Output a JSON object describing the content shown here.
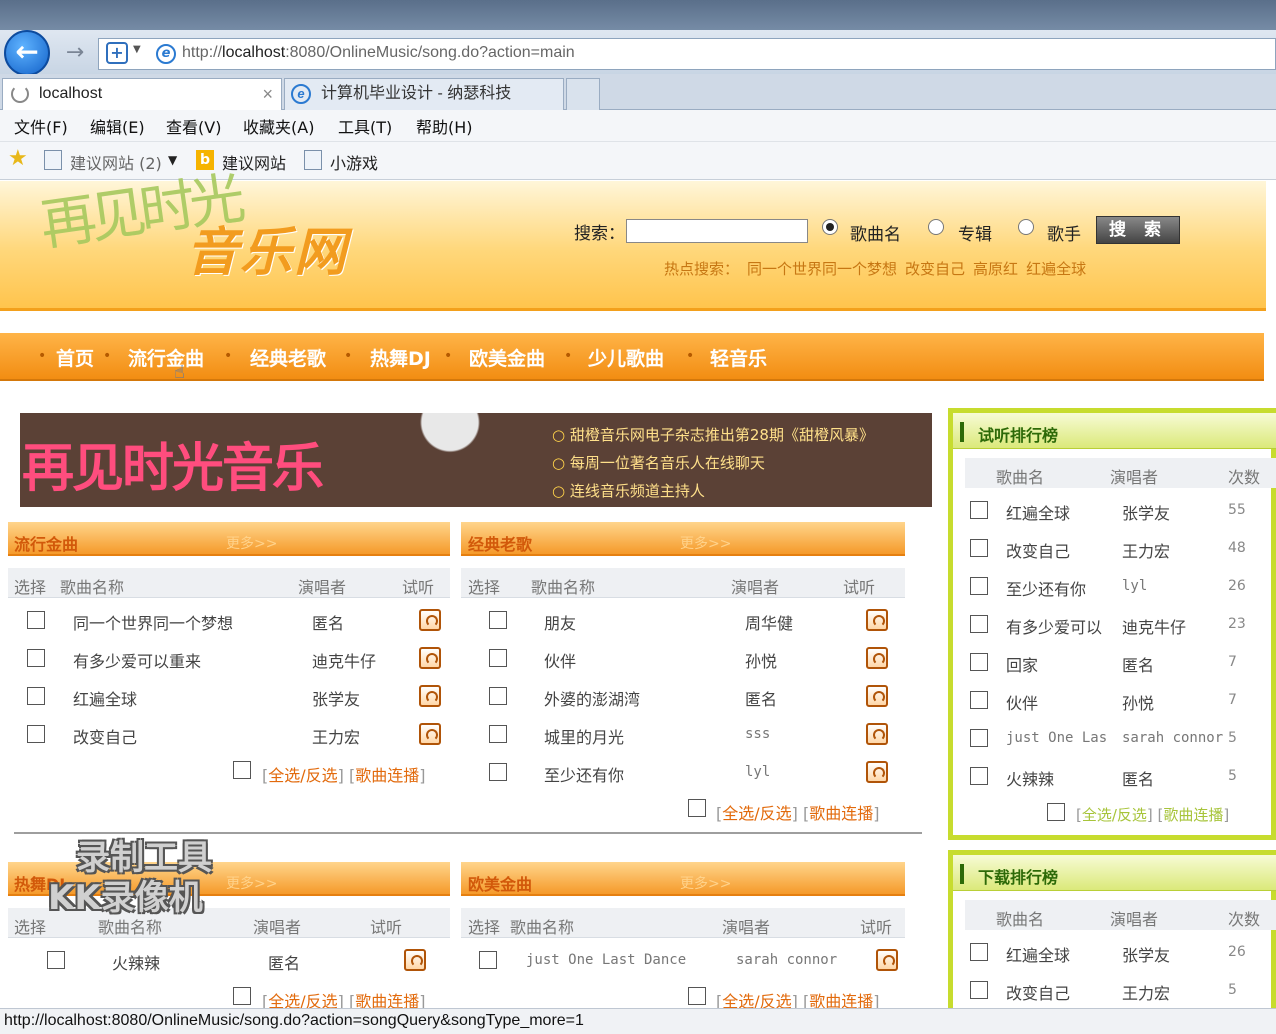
{
  "browser": {
    "url_prefix": "http://",
    "url_host": "localhost",
    "url_rest": ":8080/OnlineMusic/song.do?action=main",
    "tabs": [
      {
        "label": "localhost"
      },
      {
        "label": "计算机毕业设计 - 纳瑟科技"
      }
    ],
    "tab_close": "×",
    "menu": [
      "文件(F)",
      "编辑(E)",
      "查看(V)",
      "收藏夹(A)",
      "工具(T)",
      "帮助(H)"
    ],
    "favorites": [
      "建议网站 (2)",
      "建议网站",
      "小游戏"
    ],
    "status_url": "http://localhost:8080/OnlineMusic/song.do?action=songQuery&songType_more=1"
  },
  "header": {
    "logo_text": "再见时光",
    "site_name": "音乐网",
    "search_label": "搜索：",
    "search_options": [
      "歌曲名",
      "专辑",
      "歌手"
    ],
    "search_selected": "歌曲名",
    "search_button": "搜 索",
    "hot_label": "热点搜索：",
    "hot_terms": [
      "同一个世界同一个梦想",
      "改变自己",
      "高原红",
      "红遍全球"
    ]
  },
  "nav": [
    "首页",
    "流行金曲",
    "经典老歌",
    "热舞DJ",
    "欧美金曲",
    "少儿歌曲",
    "轻音乐"
  ],
  "banner": {
    "title": "再见时光音乐",
    "lines": [
      "甜橙音乐网电子杂志推出第28期《甜橙风暴》",
      "每周一位著名音乐人在线聊天",
      "连线音乐频道主持人"
    ]
  },
  "common": {
    "more": "更多>>",
    "select_all": "全选/反选",
    "continuous_play": "歌曲连播",
    "col_select": "选择",
    "col_song": "歌曲名称",
    "col_singer": "演唱者",
    "col_listen": "试听"
  },
  "boxes": {
    "pop": {
      "title": "流行金曲",
      "songs": [
        {
          "name": "同一个世界同一个梦想",
          "singer": "匿名"
        },
        {
          "name": "有多少爱可以重来",
          "singer": "迪克牛仔"
        },
        {
          "name": "红遍全球",
          "singer": "张学友"
        },
        {
          "name": "改变自己",
          "singer": "王力宏"
        }
      ]
    },
    "classic": {
      "title": "经典老歌",
      "songs": [
        {
          "name": "朋友",
          "singer": "周华健"
        },
        {
          "name": "伙伴",
          "singer": "孙悦"
        },
        {
          "name": "外婆的澎湖湾",
          "singer": "匿名"
        },
        {
          "name": "城里的月光",
          "singer": "sss"
        },
        {
          "name": "至少还有你",
          "singer": "lyl"
        }
      ]
    },
    "dj": {
      "title": "热舞DJ",
      "songs": [
        {
          "name": "火辣辣",
          "singer": "匿名"
        }
      ]
    },
    "western": {
      "title": "欧美金曲",
      "songs": [
        {
          "name": "just One Last Dance",
          "singer": "sarah connor"
        }
      ]
    }
  },
  "sidebar": {
    "listen_rank": {
      "title": "试听排行榜",
      "cols": [
        "歌曲名",
        "演唱者",
        "次数"
      ],
      "rows": [
        {
          "name": "红遍全球",
          "singer": "张学友",
          "count": "55"
        },
        {
          "name": "改变自己",
          "singer": "王力宏",
          "count": "48"
        },
        {
          "name": "至少还有你",
          "singer": "lyl",
          "count": "26"
        },
        {
          "name": "有多少爱可以",
          "singer": "迪克牛仔",
          "count": "23"
        },
        {
          "name": "回家",
          "singer": "匿名",
          "count": "7"
        },
        {
          "name": "伙伴",
          "singer": "孙悦",
          "count": "7"
        },
        {
          "name": "just One Las",
          "singer": "sarah connor",
          "count": "5"
        },
        {
          "name": "火辣辣",
          "singer": "匿名",
          "count": "5"
        }
      ]
    },
    "download_rank": {
      "title": "下载排行榜",
      "cols": [
        "歌曲名",
        "演唱者",
        "次数"
      ],
      "rows": [
        {
          "name": "红遍全球",
          "singer": "张学友",
          "count": "26"
        },
        {
          "name": "改变自己",
          "singer": "王力宏",
          "count": "5"
        }
      ]
    }
  },
  "watermark": [
    "录制工具",
    "KK录像机"
  ]
}
